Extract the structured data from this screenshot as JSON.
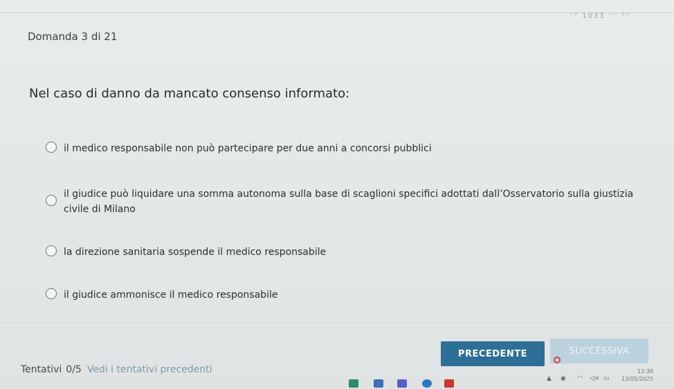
{
  "header": {
    "question_counter": "Domanda 3 di 21",
    "faint_text": "ᵔ⁷ 1033 ⁻ᵔ ⁵⁷"
  },
  "question": {
    "text": "Nel caso di danno da mancato consenso informato:",
    "options": [
      {
        "label": "il medico responsabile non può partecipare per due anni a concorsi pubblici",
        "selected": false
      },
      {
        "label": "il giudice può liquidare una somma autonoma sulla base di scaglioni specifici adottati dall’Osservatorio sulla giustizia civile di Milano",
        "selected": false
      },
      {
        "label": "la direzione sanitaria sospende il medico responsabile",
        "selected": false
      },
      {
        "label": "il giudice ammonisce il medico responsabile",
        "selected": false
      }
    ]
  },
  "footer": {
    "attempts_label": "Tentativi",
    "attempts_count": "0/5",
    "attempts_link": "Vedi i tentativi precedenti",
    "prev_button": "PRECEDENTE",
    "next_button": "SUCCESSIVA"
  },
  "taskbar": {
    "tray_icons": [
      "chevron-up-icon",
      "location-icon",
      "wifi-icon",
      "volume-icon",
      "battery-icon"
    ],
    "clock_time": "12:30",
    "clock_date": "13/05/2025"
  },
  "colors": {
    "primary_button": "#2d6f96",
    "disabled_button": "#bcd2de",
    "link": "#7f9aa8",
    "background": "#e6e9e9"
  }
}
